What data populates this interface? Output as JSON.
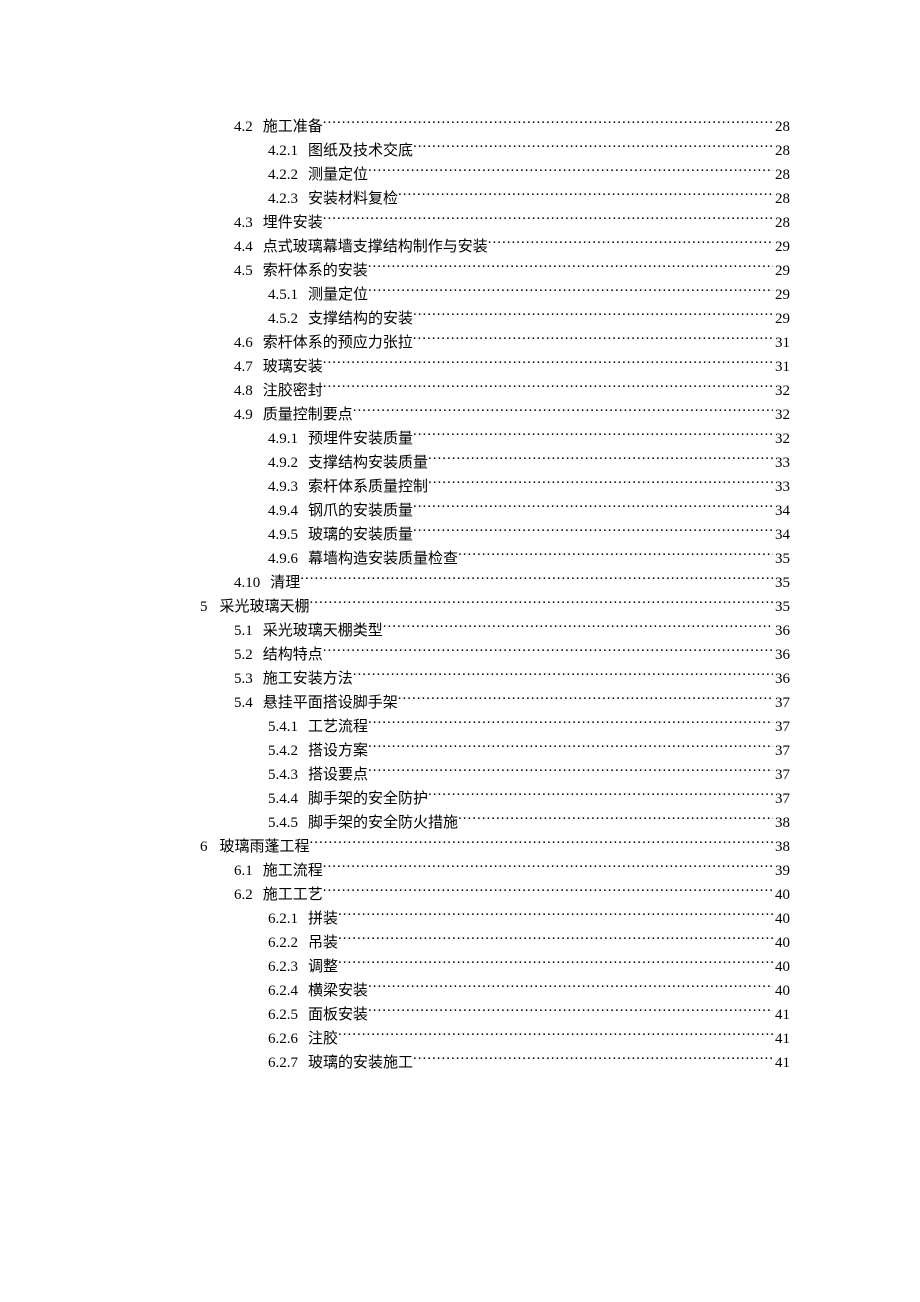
{
  "toc": [
    {
      "level": 1,
      "num": "4.2",
      "title": "施工准备",
      "page": "28"
    },
    {
      "level": 2,
      "num": "4.2.1",
      "title": "图纸及技术交底",
      "page": "28"
    },
    {
      "level": 2,
      "num": "4.2.2",
      "title": "测量定位",
      "page": "28"
    },
    {
      "level": 2,
      "num": "4.2.3",
      "title": "安装材料复检",
      "page": "28"
    },
    {
      "level": 1,
      "num": "4.3",
      "title": "埋件安装",
      "page": "28"
    },
    {
      "level": 1,
      "num": "4.4",
      "title": "点式玻璃幕墙支撑结构制作与安装",
      "page": "29"
    },
    {
      "level": 1,
      "num": "4.5",
      "title": "索杆体系的安装",
      "page": "29"
    },
    {
      "level": 2,
      "num": "4.5.1",
      "title": "测量定位",
      "page": "29"
    },
    {
      "level": 2,
      "num": "4.5.2",
      "title": "支撑结构的安装",
      "page": "29"
    },
    {
      "level": 1,
      "num": "4.6",
      "title": "索杆体系的预应力张拉",
      "page": "31"
    },
    {
      "level": 1,
      "num": "4.7",
      "title": "玻璃安装",
      "page": "31"
    },
    {
      "level": 1,
      "num": "4.8",
      "title": "注胶密封",
      "page": "32"
    },
    {
      "level": 1,
      "num": "4.9",
      "title": "质量控制要点",
      "page": "32"
    },
    {
      "level": 2,
      "num": "4.9.1",
      "title": "预埋件安装质量",
      "page": "32"
    },
    {
      "level": 2,
      "num": "4.9.2",
      "title": "支撑结构安装质量",
      "page": "33"
    },
    {
      "level": 2,
      "num": "4.9.3",
      "title": "索杆体系质量控制",
      "page": "33"
    },
    {
      "level": 2,
      "num": "4.9.4",
      "title": "钢爪的安装质量",
      "page": "34"
    },
    {
      "level": 2,
      "num": "4.9.5",
      "title": "玻璃的安装质量",
      "page": "34"
    },
    {
      "level": 2,
      "num": "4.9.6",
      "title": "幕墙构造安装质量检查",
      "page": "35"
    },
    {
      "level": 1,
      "num": "4.10",
      "title": "清理",
      "page": "35"
    },
    {
      "level": 0,
      "num": "5",
      "title": "采光玻璃天棚",
      "page": "35"
    },
    {
      "level": 1,
      "num": "5.1",
      "title": "采光玻璃天棚类型",
      "page": "36"
    },
    {
      "level": 1,
      "num": "5.2",
      "title": "结构特点",
      "page": "36"
    },
    {
      "level": 1,
      "num": "5.3",
      "title": "施工安装方法",
      "page": "36"
    },
    {
      "level": 1,
      "num": "5.4",
      "title": "悬挂平面搭设脚手架",
      "page": "37"
    },
    {
      "level": 2,
      "num": "5.4.1",
      "title": "工艺流程",
      "page": "37"
    },
    {
      "level": 2,
      "num": "5.4.2",
      "title": "搭设方案",
      "page": "37"
    },
    {
      "level": 2,
      "num": "5.4.3",
      "title": "搭设要点",
      "page": "37"
    },
    {
      "level": 2,
      "num": "5.4.4",
      "title": "脚手架的安全防护",
      "page": "37"
    },
    {
      "level": 2,
      "num": "5.4.5",
      "title": "脚手架的安全防火措施",
      "page": "38"
    },
    {
      "level": 0,
      "num": "6",
      "title": "玻璃雨蓬工程",
      "page": "38"
    },
    {
      "level": 1,
      "num": "6.1",
      "title": "施工流程",
      "page": "39"
    },
    {
      "level": 1,
      "num": "6.2",
      "title": "施工工艺",
      "page": "40"
    },
    {
      "level": 2,
      "num": "6.2.1",
      "title": "拼装",
      "page": "40"
    },
    {
      "level": 2,
      "num": "6.2.2",
      "title": "吊装",
      "page": "40"
    },
    {
      "level": 2,
      "num": "6.2.3",
      "title": "调整",
      "page": "40"
    },
    {
      "level": 2,
      "num": "6.2.4",
      "title": "横梁安装",
      "page": "40"
    },
    {
      "level": 2,
      "num": "6.2.5",
      "title": "面板安装",
      "page": "41"
    },
    {
      "level": 2,
      "num": "6.2.6",
      "title": "注胶",
      "page": "41"
    },
    {
      "level": 2,
      "num": "6.2.7",
      "title": "玻璃的安装施工",
      "page": "41"
    }
  ]
}
